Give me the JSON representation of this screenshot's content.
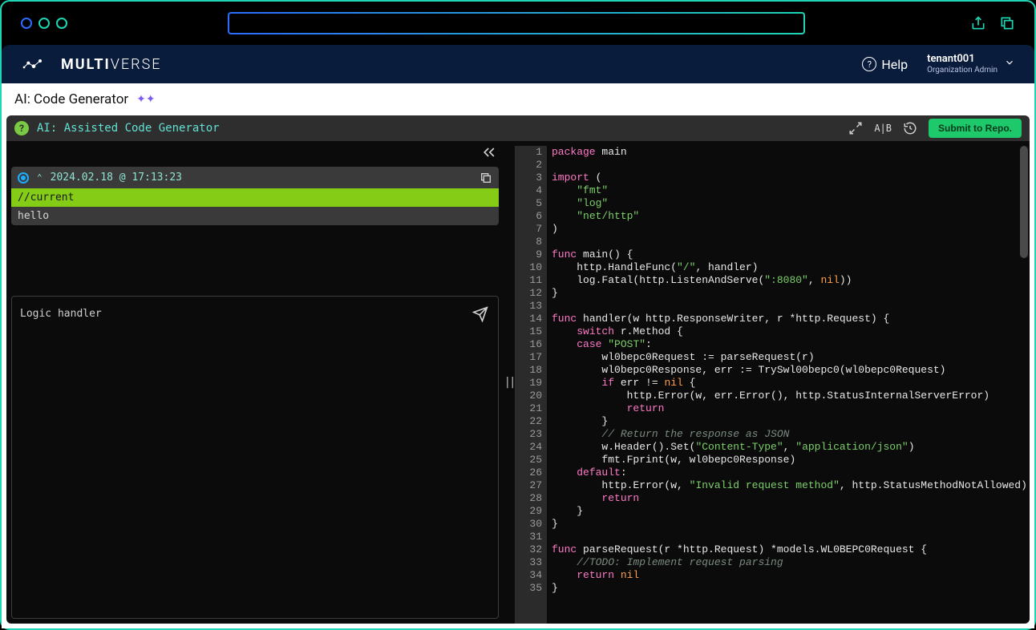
{
  "brand": {
    "name_bold": "MULTI",
    "name_light": "VERSE"
  },
  "header": {
    "help_label": "Help",
    "user_name": "tenant001",
    "user_role": "Organization Admin"
  },
  "page": {
    "title": "AI: Code Generator"
  },
  "tool": {
    "title": "AI: Assisted Code Generator",
    "ab_label": "A|B",
    "submit_label": "Submit to Repo."
  },
  "history": {
    "timestamp": "2024.02.18 @ 17:13:23",
    "rows": [
      "//current",
      "hello"
    ]
  },
  "prompt": {
    "value": "Logic handler"
  },
  "editor": {
    "lines": [
      [
        [
          "k-pkg",
          "package "
        ],
        [
          "k-ident",
          "main"
        ]
      ],
      [
        [
          "k-ident",
          ""
        ]
      ],
      [
        [
          "k-pkg",
          "import "
        ],
        [
          "k-ident",
          "("
        ]
      ],
      [
        [
          "k-ident",
          "    "
        ],
        [
          "k-str",
          "\"fmt\""
        ]
      ],
      [
        [
          "k-ident",
          "    "
        ],
        [
          "k-str",
          "\"log\""
        ]
      ],
      [
        [
          "k-ident",
          "    "
        ],
        [
          "k-str",
          "\"net/http\""
        ]
      ],
      [
        [
          "k-ident",
          ")"
        ]
      ],
      [
        [
          "k-ident",
          ""
        ]
      ],
      [
        [
          "k-pkg",
          "func "
        ],
        [
          "k-ident",
          "main() {"
        ]
      ],
      [
        [
          "k-ident",
          "    http.HandleFunc("
        ],
        [
          "k-str",
          "\"/\""
        ],
        [
          "k-ident",
          ", handler)"
        ]
      ],
      [
        [
          "k-ident",
          "    log.Fatal(http.ListenAndServe("
        ],
        [
          "k-str",
          "\":8080\""
        ],
        [
          "k-ident",
          ", "
        ],
        [
          "k-nil",
          "nil"
        ],
        [
          "k-ident",
          "))"
        ]
      ],
      [
        [
          "k-ident",
          "}"
        ]
      ],
      [
        [
          "k-ident",
          ""
        ]
      ],
      [
        [
          "k-pkg",
          "func "
        ],
        [
          "k-ident",
          "handler(w http.ResponseWriter, r *http.Request) {"
        ]
      ],
      [
        [
          "k-ident",
          "    "
        ],
        [
          "k-pkg",
          "switch "
        ],
        [
          "k-ident",
          "r.Method {"
        ]
      ],
      [
        [
          "k-ident",
          "    "
        ],
        [
          "k-pkg",
          "case "
        ],
        [
          "k-str",
          "\"POST\""
        ],
        [
          "k-ident",
          ":"
        ]
      ],
      [
        [
          "k-ident",
          "        wl0bepc0Request := parseRequest(r)"
        ]
      ],
      [
        [
          "k-ident",
          "        wl0bepc0Response, err := TrySwl00bepc0(wl0bepc0Request)"
        ]
      ],
      [
        [
          "k-ident",
          "        "
        ],
        [
          "k-pkg",
          "if "
        ],
        [
          "k-ident",
          "err != "
        ],
        [
          "k-nil",
          "nil"
        ],
        [
          "k-ident",
          " {"
        ]
      ],
      [
        [
          "k-ident",
          "            http.Error(w, err.Error(), http.StatusInternalServerError)"
        ]
      ],
      [
        [
          "k-ident",
          "            "
        ],
        [
          "k-pkg",
          "return"
        ]
      ],
      [
        [
          "k-ident",
          "        }"
        ]
      ],
      [
        [
          "k-ident",
          "        "
        ],
        [
          "k-comment",
          "// Return the response as JSON"
        ]
      ],
      [
        [
          "k-ident",
          "        w.Header().Set("
        ],
        [
          "k-str",
          "\"Content-Type\""
        ],
        [
          "k-ident",
          ", "
        ],
        [
          "k-str",
          "\"application/json\""
        ],
        [
          "k-ident",
          ")"
        ]
      ],
      [
        [
          "k-ident",
          "        fmt.Fprint(w, wl0bepc0Response)"
        ]
      ],
      [
        [
          "k-ident",
          "    "
        ],
        [
          "k-pkg",
          "default"
        ],
        [
          "k-ident",
          ":"
        ]
      ],
      [
        [
          "k-ident",
          "        http.Error(w, "
        ],
        [
          "k-str",
          "\"Invalid request method\""
        ],
        [
          "k-ident",
          ", http.StatusMethodNotAllowed)"
        ]
      ],
      [
        [
          "k-ident",
          "        "
        ],
        [
          "k-pkg",
          "return"
        ]
      ],
      [
        [
          "k-ident",
          "    }"
        ]
      ],
      [
        [
          "k-ident",
          "}"
        ]
      ],
      [
        [
          "k-ident",
          ""
        ]
      ],
      [
        [
          "k-pkg",
          "func "
        ],
        [
          "k-ident",
          "parseRequest(r *http.Request) *models.WL0BEPC0Request {"
        ]
      ],
      [
        [
          "k-ident",
          "    "
        ],
        [
          "k-comment",
          "//TODO: Implement request parsing"
        ]
      ],
      [
        [
          "k-ident",
          "    "
        ],
        [
          "k-pkg",
          "return "
        ],
        [
          "k-nil",
          "nil"
        ]
      ],
      [
        [
          "k-ident",
          "}"
        ]
      ]
    ]
  }
}
